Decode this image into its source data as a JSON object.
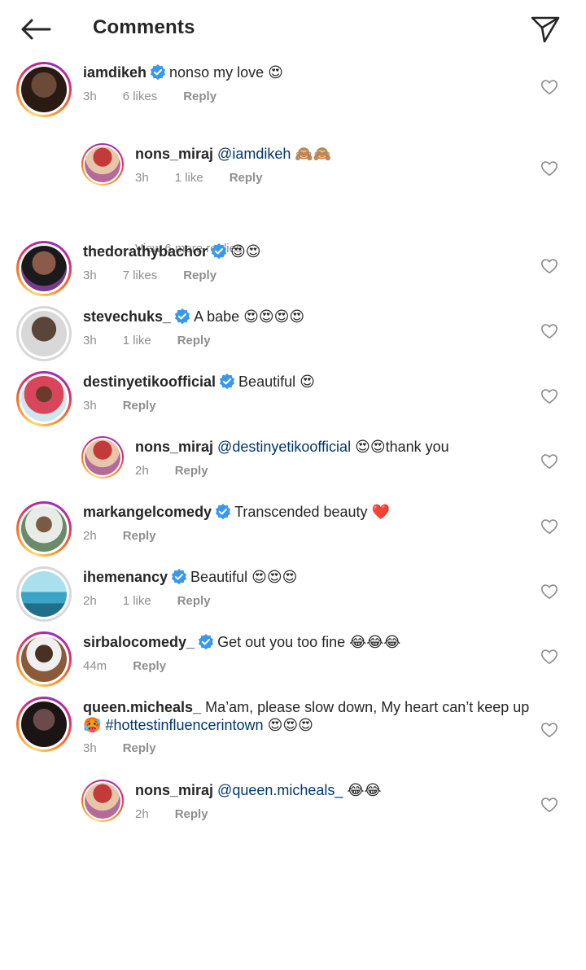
{
  "header": {
    "title": "Comments",
    "back_icon": "arrow-left-icon",
    "send_icon": "paper-plane-icon"
  },
  "colors": {
    "text": "#262626",
    "meta": "#8e8e8e",
    "link": "#00376b",
    "verified": "#3897f0"
  },
  "comments": [
    {
      "username": "iamdikeh",
      "verified": true,
      "text": "nonso my love 😍",
      "time": "3h",
      "likes": "6 likes",
      "reply": "Reply",
      "avatar_color": "#3a2a20"
    },
    {
      "username": "nons_miraj",
      "verified": false,
      "mention": "@iamdikeh",
      "text": " 🙈🙈",
      "time": "3h",
      "likes": "1 like",
      "reply": "Reply",
      "avatar_color": "#b0383a"
    },
    {
      "view_more": "View 6 more replies"
    },
    {
      "username": "thedorathybachor",
      "verified": true,
      "text": "😍😍",
      "time": "3h",
      "likes": "7 likes",
      "reply": "Reply",
      "avatar_color": "#6b3a7a"
    },
    {
      "username": "stevechuks_",
      "verified": true,
      "text": "A babe 😍😍😍😍",
      "time": "3h",
      "likes": "1 like",
      "reply": "Reply",
      "avatar_color": "#555555"
    },
    {
      "username": "destinyetikoofficial",
      "verified": true,
      "text": "Beautiful 😍",
      "time": "3h",
      "reply": "Reply",
      "avatar_color": "#d9455a"
    },
    {
      "username": "nons_miraj",
      "verified": false,
      "mention": "@destinyetikoofficial",
      "text": " 😍😍thank you",
      "time": "2h",
      "reply": "Reply",
      "avatar_color": "#b0383a"
    },
    {
      "username": "markangelcomedy",
      "verified": true,
      "text": "Transcended beauty ❤️",
      "time": "2h",
      "reply": "Reply",
      "avatar_color": "#6a8a6a"
    },
    {
      "username": "ihemenancy",
      "verified": true,
      "text": "Beautiful 😍😍😍",
      "time": "2h",
      "likes": "1 like",
      "reply": "Reply",
      "avatar_color": "#3ba4c7"
    },
    {
      "username": "sirbalocomedy_",
      "verified": true,
      "text": "Get out you too fine 😂😂😂",
      "time": "44m",
      "reply": "Reply",
      "avatar_color": "#8a5a3a"
    },
    {
      "username": "queen.micheals_",
      "verified": false,
      "text_line1": "Ma’am, please slow down, My heart can’t keep up",
      "text_line2_emoji": "🥵",
      "hashtag": "#hottestinfluencerintown",
      "text_line2_tail": " 😍😍😍",
      "time": "3h",
      "reply": "Reply",
      "avatar_color": "#4a3a3a"
    },
    {
      "username": "nons_miraj",
      "verified": false,
      "mention": "@queen.micheals_",
      "text": " 😂😂",
      "time": "2h",
      "reply": "Reply",
      "avatar_color": "#b0383a"
    }
  ]
}
